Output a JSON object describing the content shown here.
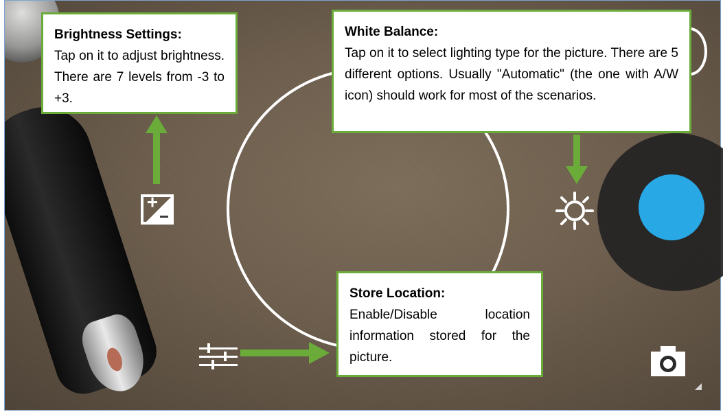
{
  "callouts": {
    "brightness": {
      "title": "Brightness Settings:",
      "body": "Tap on it to adjust brightness. There are 7 levels from -3 to +3."
    },
    "white_balance": {
      "title": "White Balance:",
      "body": "Tap on it to select lighting type for the picture. There are 5 different options. Usually \"Automatic\" (the one with A/W icon) should work for most of the scenarios."
    },
    "store_location": {
      "title": "Store Location:",
      "body": "Enable/Disable location information stored for the picture."
    }
  },
  "icons": {
    "exposure": "exposure-compensation-icon",
    "white_balance": "white-balance-sun-icon",
    "settings": "settings-sliders-icon",
    "camera_switch": "camera-switch-icon",
    "shutter": "shutter-button"
  },
  "colors": {
    "callout_border": "#6aab3a",
    "arrow": "#6aab3a",
    "shutter": "#29a8e6",
    "shutter_ring": "#232323"
  }
}
